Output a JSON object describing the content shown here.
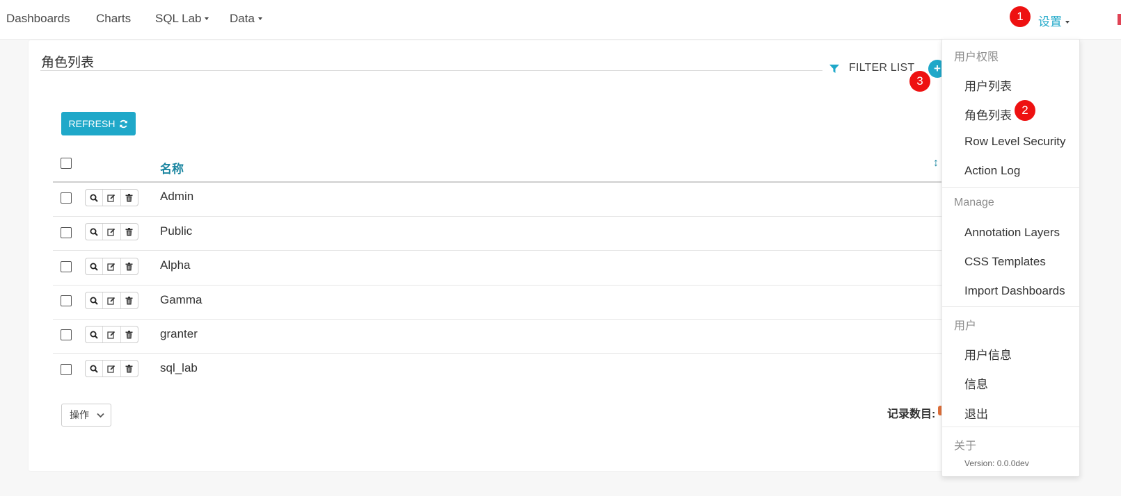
{
  "nav": {
    "dashboards": "Dashboards",
    "charts": "Charts",
    "sql_lab": "SQL Lab",
    "data": "Data",
    "settings": "设置"
  },
  "markers": {
    "m1": "1",
    "m2": "2",
    "m3": "3"
  },
  "page": {
    "title": "角色列表",
    "filter_list": "FILTER LIST",
    "add_symbol": "+",
    "refresh": "REFRESH"
  },
  "table": {
    "column_name": "名称",
    "sort_icon": "↕",
    "rows": [
      {
        "name": "Admin"
      },
      {
        "name": "Public"
      },
      {
        "name": "Alpha"
      },
      {
        "name": "Gamma"
      },
      {
        "name": "granter"
      },
      {
        "name": "sql_lab"
      }
    ]
  },
  "footer": {
    "actions": "操作",
    "records": "记录数目:"
  },
  "dropdown": {
    "section_permissions": "用户权限",
    "user_list": "用户列表",
    "role_list": "角色列表",
    "row_level_security": "Row Level Security",
    "action_log": "Action Log",
    "section_manage": "Manage",
    "annotation_layers": "Annotation Layers",
    "css_templates": "CSS Templates",
    "import_dashboards": "Import Dashboards",
    "section_user": "用户",
    "user_info": "用户信息",
    "info": "信息",
    "logout": "退出",
    "section_about": "关于",
    "version": "Version: 0.0.0dev"
  },
  "colors": {
    "accent": "#1fa8c9",
    "marker": "#ee1111",
    "header_link": "#1a85a0"
  },
  "icons": [
    "caret-down-icon",
    "filter-icon",
    "plus-icon",
    "refresh-icon",
    "search-icon",
    "edit-icon",
    "trash-icon",
    "sort-icon",
    "chevron-down-icon"
  ]
}
